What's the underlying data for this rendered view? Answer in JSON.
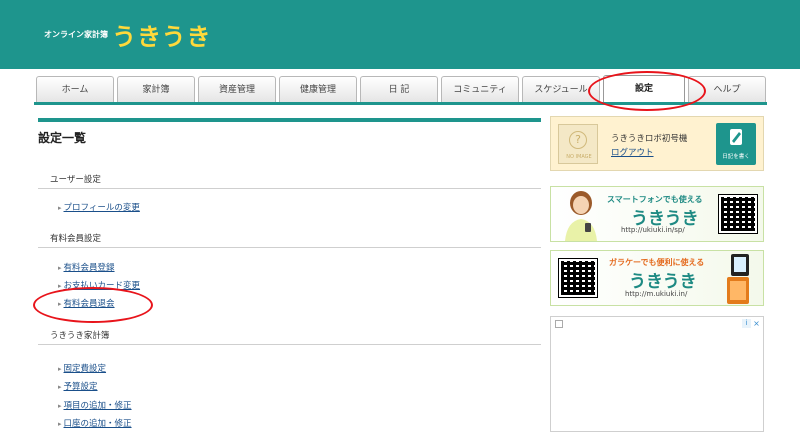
{
  "header": {
    "brand_small": "オンライン家計簿",
    "brand_logo": "うきうき"
  },
  "tabs": [
    {
      "label": "ホーム",
      "active": false
    },
    {
      "label": "家計簿",
      "active": false
    },
    {
      "label": "資産管理",
      "active": false
    },
    {
      "label": "健康管理",
      "active": false
    },
    {
      "label": "日 記",
      "active": false
    },
    {
      "label": "コミュニティ",
      "active": false
    },
    {
      "label": "スケジュール",
      "active": false
    },
    {
      "label": "設定",
      "active": true
    },
    {
      "label": "ヘルプ",
      "active": false
    }
  ],
  "main": {
    "title": "設定一覧",
    "sections": [
      {
        "heading": "ユーザー設定",
        "links": [
          "プロフィールの変更"
        ]
      },
      {
        "heading": "有料会員設定",
        "links": [
          "有料会員登録",
          "お支払いカード変更",
          "有料会員退会"
        ]
      },
      {
        "heading": "うきうき家計簿",
        "links": [
          "固定費設定",
          "予算設定",
          "項目の追加・修正",
          "口座の追加・修正"
        ]
      }
    ]
  },
  "sidebar": {
    "profile": {
      "avatar_text": "NO IMAGE",
      "avatar_glyph": "?",
      "name": "うきうきロボ初号機",
      "logout": "ログアウト",
      "diary_button": "日記を書く"
    },
    "ad_smartphone": {
      "tagline": "スマートフォンでも使える",
      "title": "うきうき",
      "url": "http://ukiuki.in/sp/"
    },
    "ad_feature_phone": {
      "tagline": "ガラケーでも便利に使える",
      "title": "うきうき",
      "url": "http://m.ukiuki.in/"
    },
    "ad_slot": {
      "adchoices_glyph": "i",
      "close_glyph": "×"
    }
  },
  "colors": {
    "brand_teal": "#1e958d",
    "logo_yellow": "#ffd93b",
    "link_blue": "#1a4f8a",
    "annotation_red": "#e8141b"
  }
}
